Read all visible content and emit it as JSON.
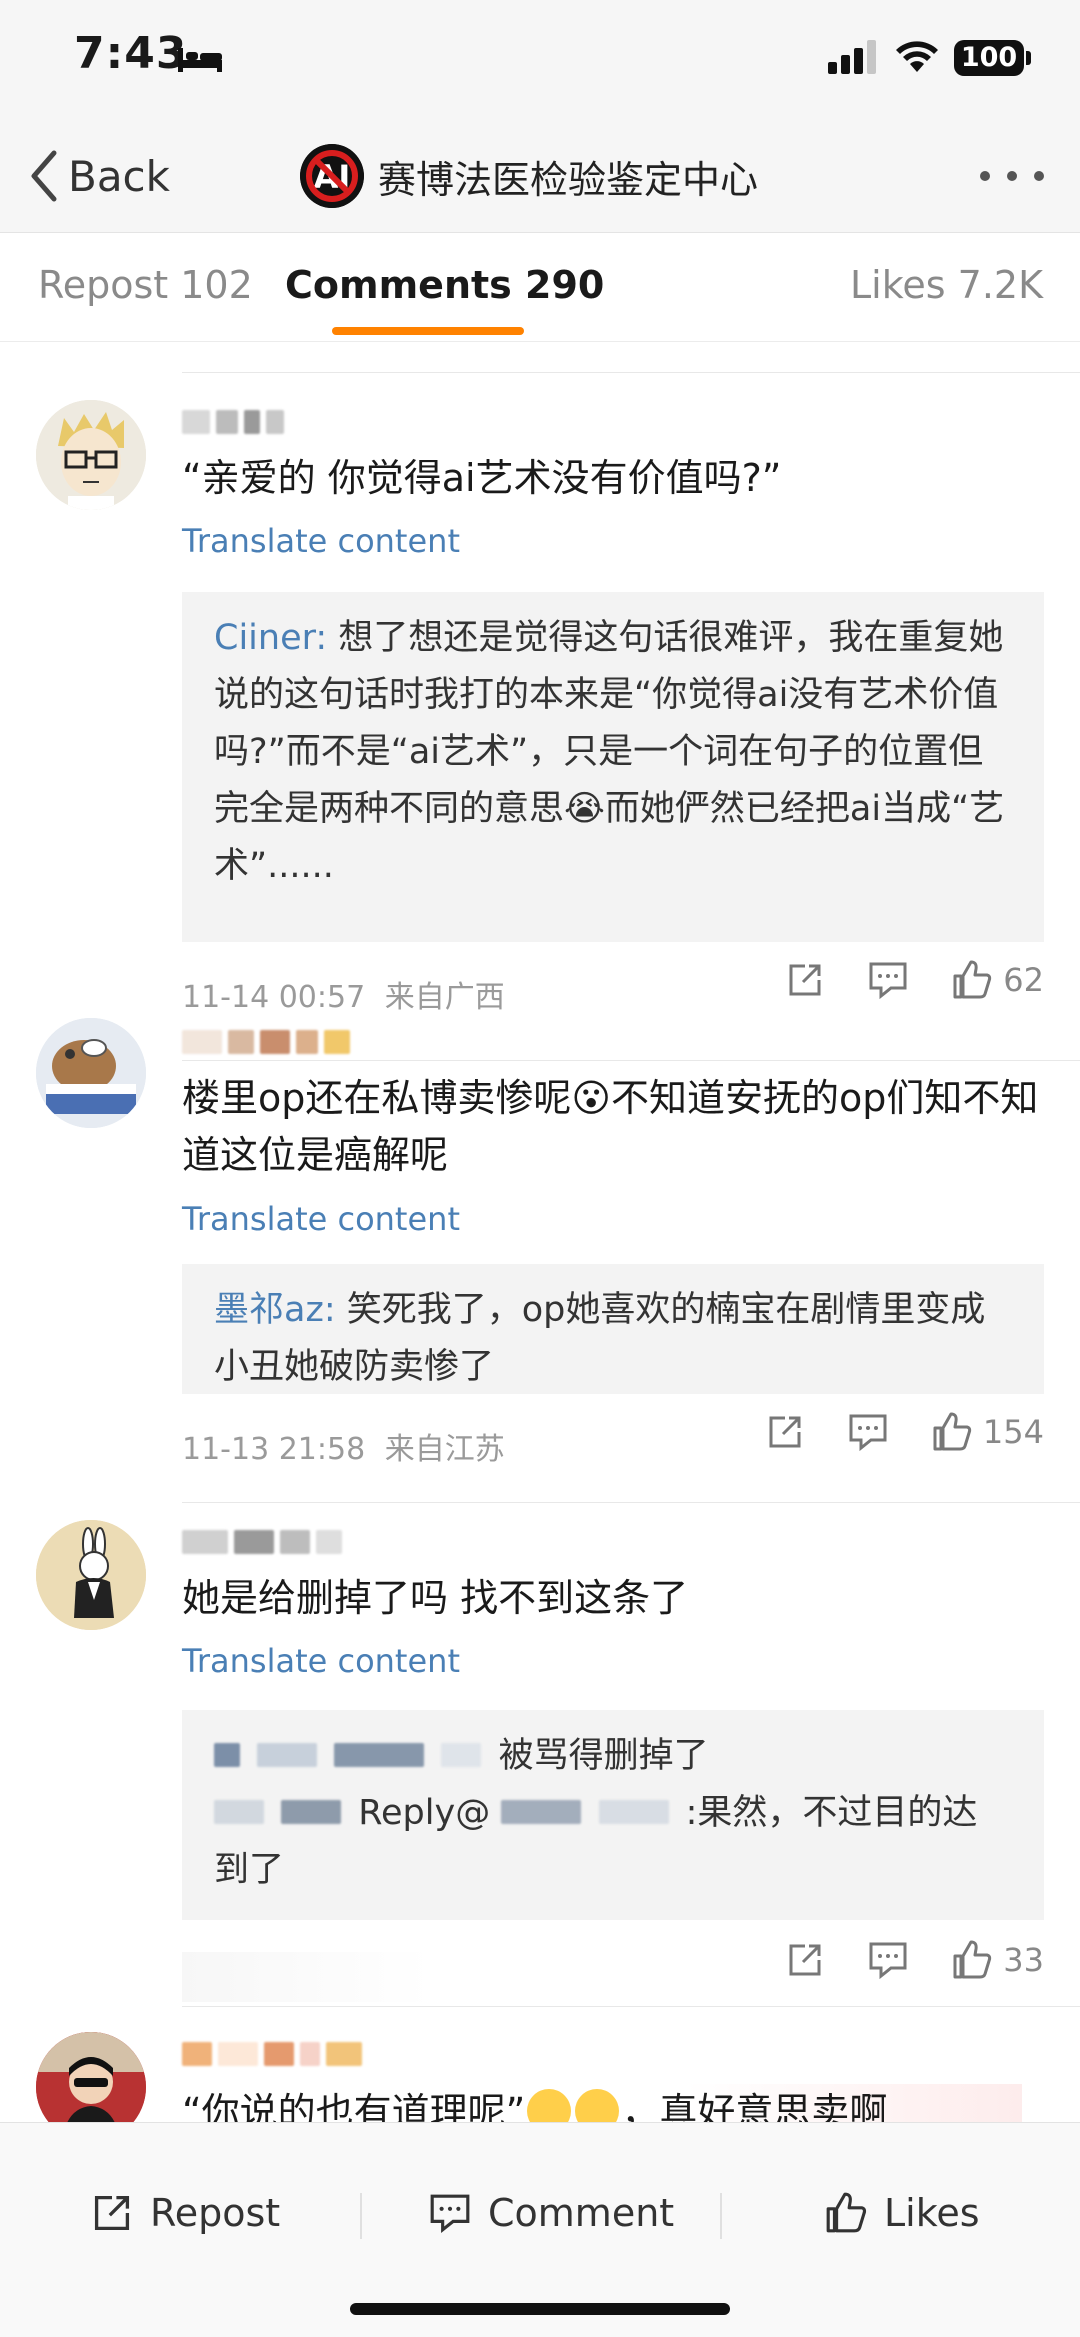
{
  "status_bar": {
    "time": "7:43",
    "battery": "100"
  },
  "nav": {
    "back_label": "Back",
    "title": "赛博法医检验鉴定中心",
    "avatar_text": "AI"
  },
  "tabs": [
    {
      "label": "Repost 102",
      "active": false
    },
    {
      "label": "Comments 290",
      "active": true
    },
    {
      "label": "Likes 7.2K",
      "active": false
    }
  ],
  "colors": {
    "accent": "#ff8200",
    "link": "#4a7fb5",
    "muted": "#9a9a9a"
  },
  "comments": [
    {
      "text": "“亲爱的 你觉得ai艺术没有价值吗?”",
      "translate_label": "Translate content",
      "reply": {
        "author": "Ciiner:",
        "text": "想了想还是觉得这句话很难评，我在重复她说的这句话时我打的本来是“你觉得ai没有艺术价值吗?”而不是“ai艺术”，只是一个词在句子的位置但完全是两种不同的意思😭而她俨然已经把ai当成“艺术”......"
      },
      "time": "11-14 00:57",
      "location": "来自广西",
      "likes": "62"
    },
    {
      "text": "楼里op还在私博卖惨呢😮不知道安抚的op们知不知道这位是癌解呢",
      "translate_label": "Translate content",
      "reply": {
        "author": "墨祁az:",
        "text": "笑死我了，op她喜欢的楠宝在剧情里变成小丑她破防卖惨了"
      },
      "time": "11-13 21:58",
      "location": "来自江苏",
      "likes": "154"
    },
    {
      "text": "她是给删掉了吗 找不到这条了",
      "translate_label": "Translate content",
      "reply": {
        "line1": "被骂得删掉了",
        "line2_prefix": "Reply@",
        "line2_suffix": ":果然，不过目的达到了"
      },
      "likes": "33"
    },
    {
      "text_prefix": "“你说的也有道理呢”",
      "text_suffix": "，真好意思卖啊"
    }
  ],
  "bottom_bar": {
    "repost": "Repost",
    "comment": "Comment",
    "likes": "Likes"
  }
}
